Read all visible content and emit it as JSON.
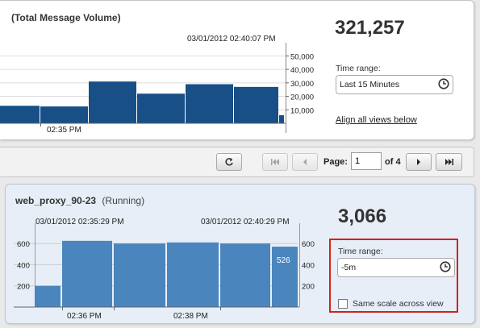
{
  "top": {
    "title": "(Total Message Volume)",
    "timestamp": "03/01/2012 02:40:07 PM",
    "y_ticks": [
      "50,000",
      "40,000",
      "30,000",
      "20,000",
      "10,000"
    ],
    "x_label": "02:35 PM",
    "big_number": "321,257",
    "time_range_label": "Time range:",
    "time_range_value": "Last 15 Minutes",
    "align_link": "Align all views below",
    "bar_color": "#184f87"
  },
  "pager": {
    "page_label": "Page:",
    "page_value": "1",
    "of_label": "of 4"
  },
  "bottom": {
    "title": "web_proxy_90-23",
    "status": "(Running)",
    "ts_left": "03/01/2012 02:35:29 PM",
    "ts_right": "03/01/2012 02:40:29 PM",
    "y_ticks": [
      "600",
      "400",
      "200"
    ],
    "x_labels": [
      "02:36 PM",
      "02:38 PM"
    ],
    "last_value_label": "526",
    "big_number": "3,066",
    "time_range_label": "Time range:",
    "time_range_value": "-5m",
    "same_scale_label": "Same scale across view",
    "same_scale_checked": false,
    "bar_color": "#4a86bd"
  },
  "chart_data": [
    {
      "type": "bar",
      "title": "(Total Message Volume)",
      "xlabel": "",
      "ylabel": "",
      "ylim": [
        0,
        55000
      ],
      "values": [
        13000,
        12500,
        31000,
        22000,
        29000,
        27000,
        6000
      ]
    },
    {
      "type": "bar",
      "title": "web_proxy_90-23",
      "xlabel": "",
      "ylabel": "",
      "ylim": [
        0,
        700
      ],
      "values": [
        200,
        625,
        600,
        610,
        600,
        570,
        526
      ]
    }
  ]
}
